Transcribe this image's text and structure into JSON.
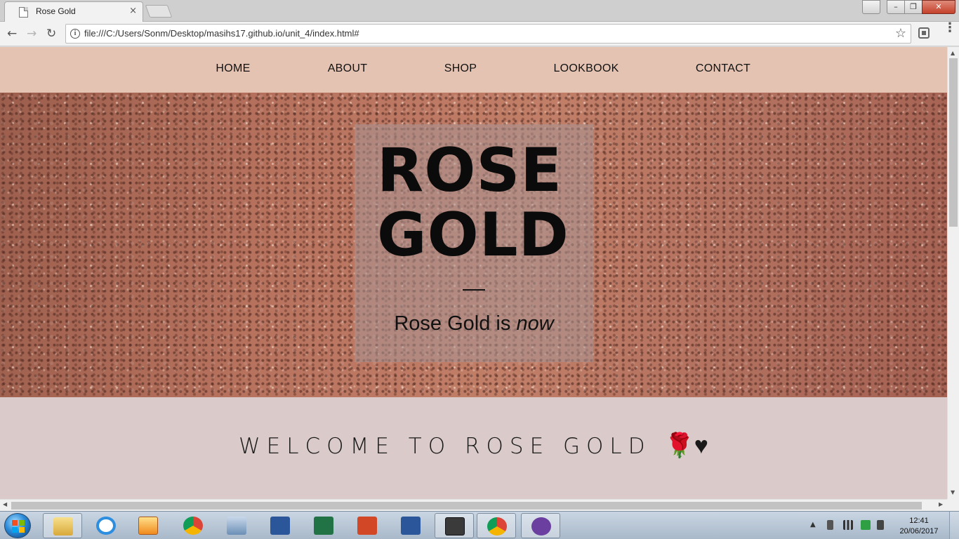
{
  "browser": {
    "tab_title": "Rose Gold",
    "tab_close": "×",
    "url": "file:///C:/Users/Sonm/Desktop/masihs17.github.io/unit_4/index.html#",
    "window_buttons": {
      "minimize": "–",
      "maximize": "❐",
      "close": "✕",
      "user": "👤"
    },
    "nav": {
      "back": "←",
      "forward": "→",
      "reload": "↻",
      "star": "☆",
      "info": "i",
      "menu": "⋮"
    }
  },
  "site": {
    "nav": [
      "HOME",
      "ABOUT",
      "SHOP",
      "LOOKBOOK",
      "CONTACT"
    ],
    "hero": {
      "title_line1": "ROSE",
      "title_line2": "GOLD",
      "tagline_main": "Rose Gold is ",
      "tagline_em": "now"
    },
    "welcome": {
      "text": "WELCOME TO ROSE GOLD ",
      "icons": "🌹♥"
    },
    "colors": {
      "nav_bg": "#e5c3b2",
      "section_bg": "#dacbca",
      "hero_base": "#b8735e"
    }
  },
  "taskbar": {
    "time": "12:41",
    "date": "20/06/2017",
    "items": [
      "file-explorer-icon",
      "internet-explorer-icon",
      "media-player-icon",
      "chrome-icon",
      "network-icon",
      "word-icon",
      "excel-icon",
      "powerpoint-icon",
      "word-icon",
      "sublime-text-icon",
      "chrome-icon",
      "cat-app-icon"
    ],
    "tray_arrow": "▲"
  }
}
